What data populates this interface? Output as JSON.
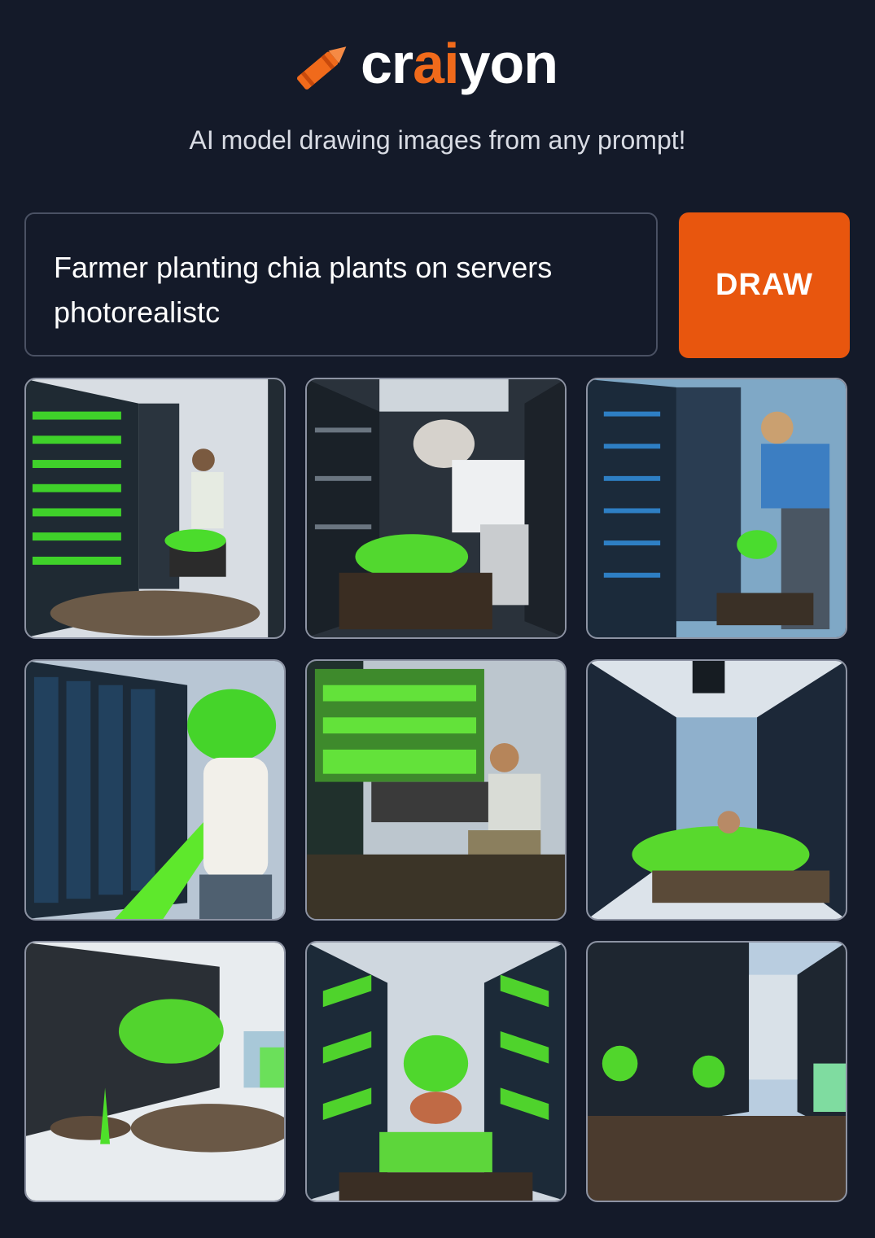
{
  "brand": {
    "prefix": "cr",
    "highlight": "ai",
    "suffix": "yon"
  },
  "tagline": "AI model drawing images from any prompt!",
  "prompt": {
    "value": "Farmer planting chia plants on servers photorealistc"
  },
  "draw_button": {
    "label": "DRAW"
  },
  "colors": {
    "background": "#141a29",
    "accent": "#e8560e",
    "brand_ai": "#f06a1b"
  },
  "icons": {
    "logo": "crayon-icon"
  },
  "results": [
    {
      "name": "generated-image-1",
      "description_icon": "image"
    },
    {
      "name": "generated-image-2",
      "description_icon": "image"
    },
    {
      "name": "generated-image-3",
      "description_icon": "image"
    },
    {
      "name": "generated-image-4",
      "description_icon": "image"
    },
    {
      "name": "generated-image-5",
      "description_icon": "image"
    },
    {
      "name": "generated-image-6",
      "description_icon": "image"
    },
    {
      "name": "generated-image-7",
      "description_icon": "image"
    },
    {
      "name": "generated-image-8",
      "description_icon": "image"
    },
    {
      "name": "generated-image-9",
      "description_icon": "image"
    }
  ]
}
